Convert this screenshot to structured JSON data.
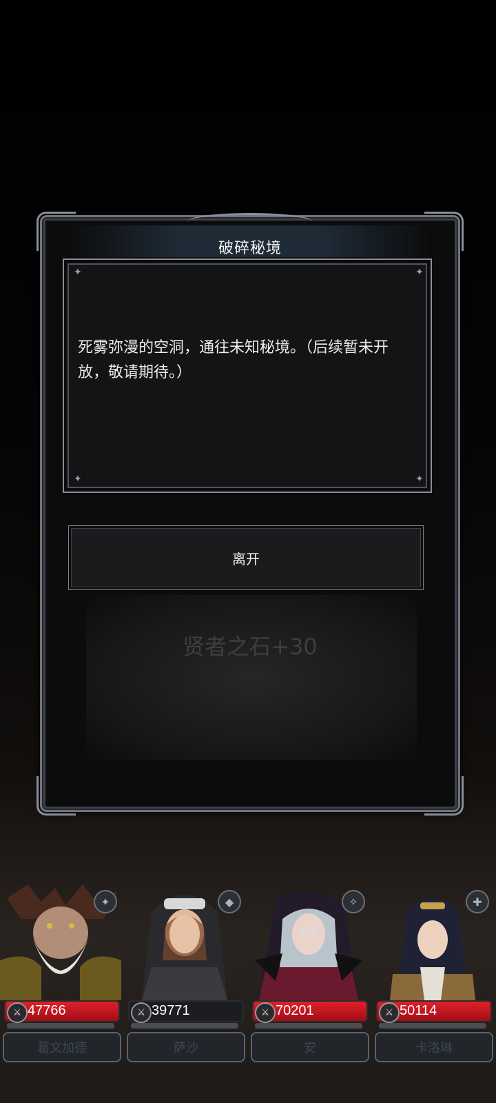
{
  "dialog": {
    "title": "破碎秘境",
    "description": "死雾弥漫的空洞，通往未知秘境。（后续暂未开放，敬请期待。）",
    "leave_label": "离开",
    "reward_text": "贤者之石+30"
  },
  "party": [
    {
      "hp": "47766",
      "name": "葛文加德",
      "icon": "sword-class-icon",
      "hp_bar_color": "#c8151f"
    },
    {
      "hp": "39771",
      "name": "萨沙",
      "icon": "shield-class-icon",
      "hp_bar_color": "#1c1d20"
    },
    {
      "hp": "70201",
      "name": "安",
      "icon": "magic-class-icon",
      "hp_bar_color": "#c8151f"
    },
    {
      "hp": "50114",
      "name": "卡洛琳",
      "icon": "holy-class-icon",
      "hp_bar_color": "#c8151f"
    }
  ]
}
